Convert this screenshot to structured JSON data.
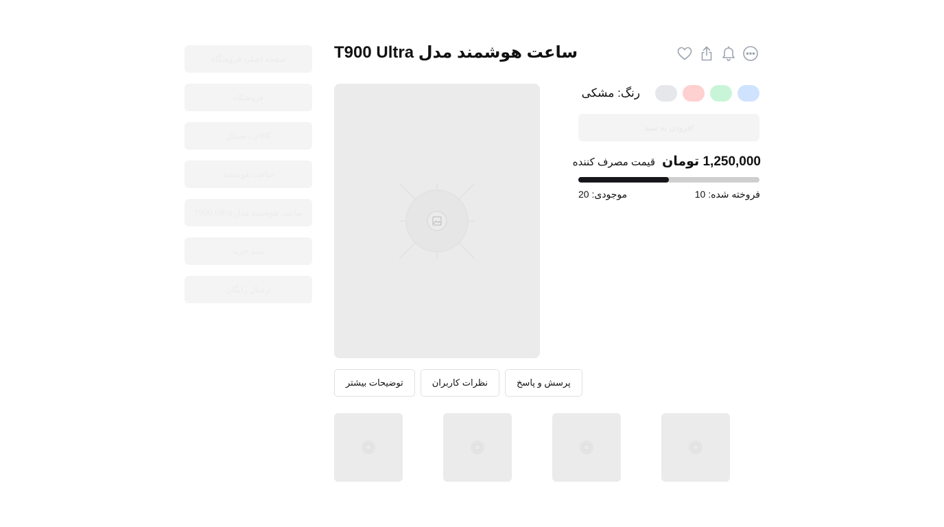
{
  "sidebar": {
    "items": [
      {
        "label": "صفحه اصلی فروشگاه"
      },
      {
        "label": "فروشگاه"
      },
      {
        "label": "کالای دیجیتال"
      },
      {
        "label": "ساعت هوشمند"
      },
      {
        "label": "ساعت هوشمند مدل T900 Ultra"
      },
      {
        "label": "سبد خرید"
      },
      {
        "label": "ارسال رایگان"
      }
    ]
  },
  "product": {
    "title": "ساعت هوشمند مدل T900 Ultra",
    "color_label": "رنگ: مشکی",
    "swatches": [
      {
        "name": "blue",
        "color": "#cfe3ff"
      },
      {
        "name": "green",
        "color": "#c8f5d8"
      },
      {
        "name": "red",
        "color": "#ffd0d0"
      },
      {
        "name": "gray",
        "color": "#e5e7eb"
      }
    ],
    "add_to_cart": "افزودن به سبد",
    "price": "1,250,000 تومان",
    "price_label": "قیمت مصرف کننده",
    "sold_fraction": 0.5,
    "sold_text": "فروخته شده: 10",
    "stock_text": "موجودی: 20"
  },
  "actions": [
    {
      "icon": "heart-icon"
    },
    {
      "icon": "share-icon"
    },
    {
      "icon": "bell-icon"
    },
    {
      "icon": "more-icon"
    }
  ],
  "tabs": [
    {
      "label": "پرسش و پاسخ"
    },
    {
      "label": "نظرات کاربران"
    },
    {
      "label": "توضیحات بیشتر"
    }
  ],
  "colors": {
    "placeholder_bg": "#ebebeb",
    "progress_fill": "#16161a",
    "progress_track": "#cfcfcf",
    "icon_gray": "#9ca3af"
  }
}
